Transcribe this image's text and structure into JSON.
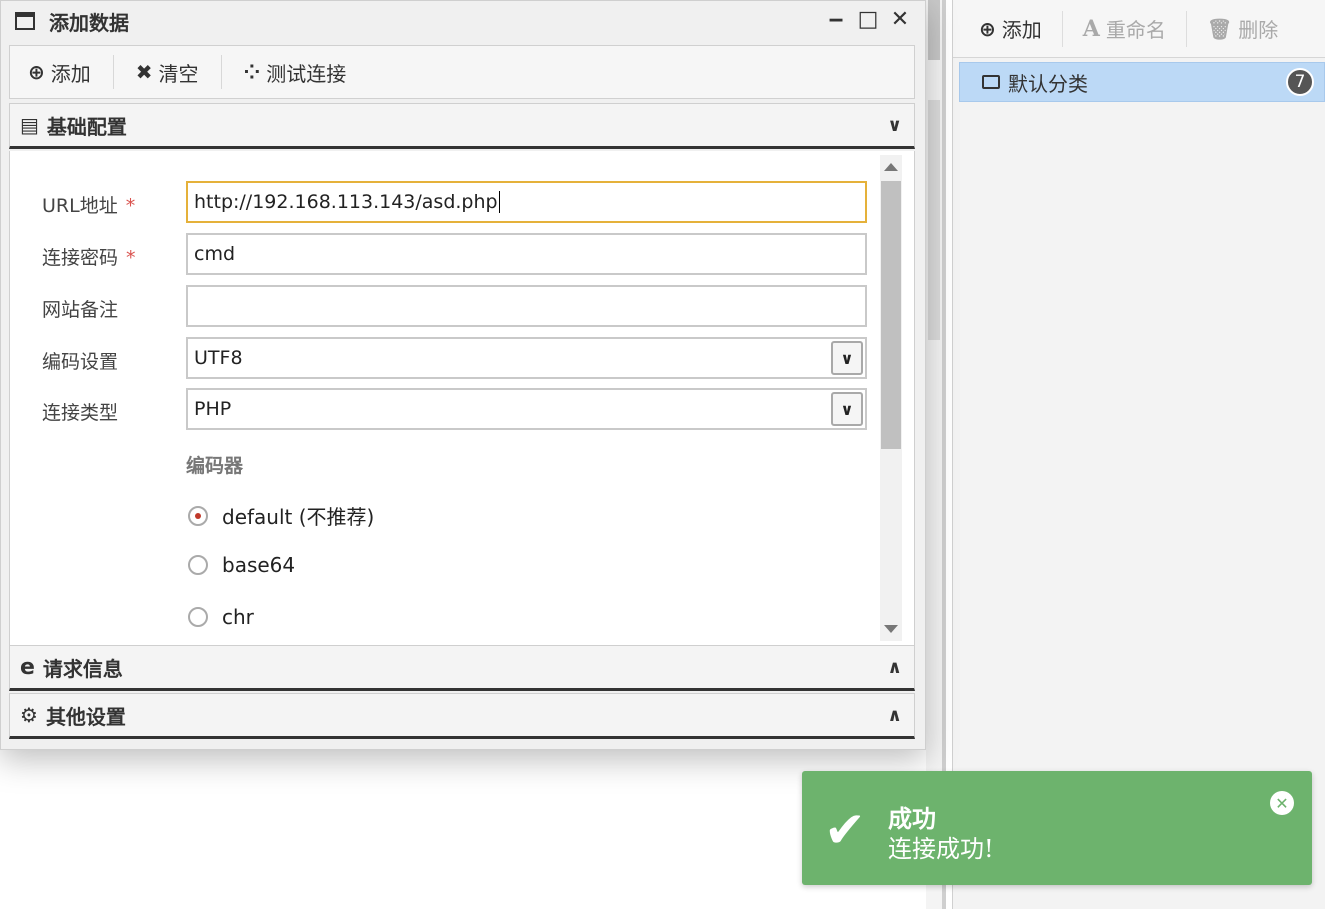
{
  "dialog": {
    "title": "添加数据",
    "controls": {
      "minimize": "‒",
      "maximize": "□",
      "close": "✕"
    }
  },
  "toolbar": {
    "add": {
      "icon": "plus-circle-icon",
      "label": "添加"
    },
    "clear": {
      "icon": "x-icon",
      "label": "清空"
    },
    "test": {
      "icon": "spinner-icon",
      "label": "测试连接"
    }
  },
  "sections": {
    "basic": {
      "icon": "document-icon",
      "label": "基础配置",
      "chevron": "⌄"
    },
    "request": {
      "icon": "ie-icon",
      "label": "请求信息",
      "chevron": "⌃"
    },
    "other": {
      "icon": "gears-icon",
      "label": "其他设置",
      "chevron": "⌃"
    }
  },
  "form": {
    "url": {
      "label": "URL地址",
      "required": "*",
      "value": "http://192.168.113.143/asd.php"
    },
    "password": {
      "label": "连接密码",
      "required": "*",
      "value": "cmd"
    },
    "note": {
      "label": "网站备注",
      "value": ""
    },
    "encoding": {
      "label": "编码设置",
      "value": "UTF8"
    },
    "type": {
      "label": "连接类型",
      "value": "PHP"
    },
    "encoder_title": "编码器",
    "encoders": [
      {
        "label": "default (不推荐)",
        "selected": true
      },
      {
        "label": "base64",
        "selected": false
      },
      {
        "label": "chr",
        "selected": false
      }
    ]
  },
  "right_panel": {
    "toolbar": {
      "add": {
        "icon": "plus-circle-icon",
        "label": "添加"
      },
      "rename": {
        "icon": "font-a-icon",
        "label": "重命名"
      },
      "delete": {
        "icon": "trash-icon",
        "label": "删除"
      }
    },
    "category": {
      "icon": "folder-icon",
      "label": "默认分类",
      "count": "7"
    }
  },
  "toast": {
    "icon": "check-icon",
    "title": "成功",
    "message": "连接成功!",
    "accent": "#6db36d"
  }
}
